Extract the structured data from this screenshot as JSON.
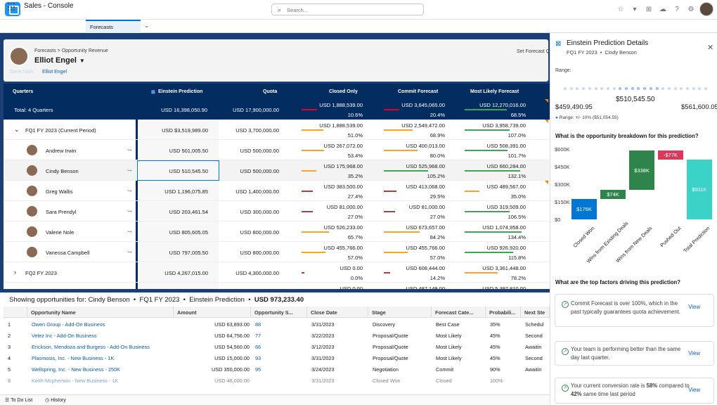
{
  "header": {
    "search_placeholder": "Search..."
  },
  "nav": {
    "app_name": "Sales - Console",
    "tab": "Forecasts"
  },
  "forecast": {
    "breadcrumb": "Forecasts > Opportunity Revenue",
    "owner": "Elliot Engel",
    "set_quota": "Set Forecast Q",
    "sub_link": "Elliot Engel",
    "sub_faint": "Steve Nieh"
  },
  "columns": {
    "quarters": "Quarters",
    "einstein": "Einstein Prediction",
    "quota": "Quota",
    "closed": "Closed Only",
    "commit": "Commit Forecast",
    "likely": "Most Likely Forecast"
  },
  "total": {
    "label": "Total: 4 Quarters",
    "einstein": "USD 16,398,050.90",
    "quota": "USD 17,900,000.00",
    "closed": "USD 1,888,539.00",
    "closed_pct": "10.6%",
    "commit": "USD 3,645,065.00",
    "commit_pct": "20.4%",
    "likely": "USD 12,270,016.00",
    "likely_pct": "68.5%"
  },
  "rows": [
    {
      "name": "FQ1 FY 2023 (Current Period)",
      "einstein": "USD $3,519,989.00",
      "quota": "USD 3,700,000.00",
      "closed": "USD 1,888,539.00",
      "closed_pct": "51.0%",
      "commit": "USD 2,549,472.00",
      "commit_pct": "68.9%",
      "likely": "USD 3,958,739.00",
      "likely_pct": "107.0%"
    },
    {
      "name": "Andrew Irwin",
      "einstein": "USD 501,005.50",
      "quota": "USD 500,000.00",
      "closed": "USD 267,072.00",
      "closed_pct": "53.4%",
      "commit": "USD 400,013.00",
      "commit_pct": "80.0%",
      "likely": "USD 508,391.00",
      "likely_pct": "101.7%"
    },
    {
      "name": "Cindy Benson",
      "einstein": "USD 510,545.50",
      "quota": "USD 500,000.00",
      "closed": "USD 175,968.00",
      "closed_pct": "35.2%",
      "commit": "USD 525,968.00",
      "commit_pct": "105.2%",
      "likely": "USD 660,284.00",
      "likely_pct": "132.1%"
    },
    {
      "name": "Greg Wallis",
      "einstein": "USD 1,196,075.85",
      "quota": "USD 1,400,000.00",
      "closed": "USD 383,500.00",
      "closed_pct": "27.4%",
      "commit": "USD 413,068.00",
      "commit_pct": "29.5%",
      "likely": "USD 489,567.00",
      "likely_pct": "35.0%"
    },
    {
      "name": "Sara Prendyl",
      "einstein": "USD 203,461.54",
      "quota": "USD 300,000.00",
      "closed": "USD 81,000.00",
      "closed_pct": "27.0%",
      "commit": "USD 81,000.00",
      "commit_pct": "27.0%",
      "likely": "USD 319,509.00",
      "likely_pct": "106.5%"
    },
    {
      "name": "Valerie Nole",
      "einstein": "USD 805,605.05",
      "quota": "USD 800,000.00",
      "closed": "USD 526,233.00",
      "closed_pct": "65.7%",
      "commit": "USD 673,657.00",
      "commit_pct": "84.2%",
      "likely": "USD 1,074,958.00",
      "likely_pct": "134.4%"
    },
    {
      "name": "Vanessa Campbell",
      "einstein": "USD 797,005.50",
      "quota": "USD 800,000.00",
      "closed": "USD 455,766.00",
      "closed_pct": "57.0%",
      "commit": "USD 455,766.00",
      "commit_pct": "57.0%",
      "likely": "USD 926,920.00",
      "likely_pct": "115.8%"
    },
    {
      "name": "FQ2 FY 2023",
      "einstein": "USD 4,267,015.00",
      "quota": "USD 4,300,000.00",
      "closed": "USD 0.00",
      "closed_pct": "0.0%",
      "commit": "USD 608,444.00",
      "commit_pct": "14.2%",
      "likely": "USD 3,361,448.00",
      "likely_pct": "78.2%"
    },
    {
      "name": "",
      "einstein": "",
      "quota": "",
      "closed": "USD 0.00",
      "closed_pct": "",
      "commit": "USD 487,149.00",
      "commit_pct": "",
      "likely": "USD 5,397,810.00",
      "likely_pct": ""
    }
  ],
  "list": {
    "showing": "Showing opportunities for: Cindy Benson",
    "period": "FQ1 FY 2023",
    "einstein": "Einstein Prediction",
    "amount": "USD 973,233.40",
    "headers": [
      "Opportunity Name",
      "Amount",
      "Opportunity S...",
      "Close Date",
      "Stage",
      "Forecast Cate...",
      "Probabili...",
      "Next Ste"
    ],
    "rows": [
      [
        "1",
        "Owen Group - Add-On Business",
        "USD 63,893.00",
        "88",
        "3/31/2023",
        "Discovery",
        "Best Case",
        "35%",
        "Schedul"
      ],
      [
        "2",
        "Velez Inc - Add-On Business",
        "USD 64,756.00",
        "77",
        "3/22/2023",
        "Proposal/Quote",
        "Most Likely",
        "45%",
        "Second"
      ],
      [
        "3",
        "Erickson, Mendoza and Burgess - Add-On Business",
        "USD 54,560.00",
        "66",
        "3/12/2023",
        "Proposal/Quote",
        "Most Likely",
        "45%",
        "Awaitin"
      ],
      [
        "4",
        "Plasmosis, Inc. - New Business - 1K",
        "USD 15,000.00",
        "93",
        "3/31/2023",
        "Proposal/Quote",
        "Most Likely",
        "45%",
        "Second"
      ],
      [
        "5",
        "Wellspring, Inc. - New Business - 250K",
        "USD 350,000.00",
        "95",
        "3/24/2023",
        "Negotiation",
        "Commit",
        "90%",
        "Awaitin"
      ],
      [
        "6",
        "Keith-Mcpherson - New Business - 1K",
        "USD 48,000.00",
        "",
        "3/31/2023",
        "Closed Won",
        "Closed",
        "100%",
        ""
      ]
    ]
  },
  "footer": {
    "todo": "To Do List",
    "history": "History"
  },
  "panel": {
    "title": "Einstein Prediction Details",
    "period": "FQ1 FY 2023",
    "person": "Cindy Benson",
    "range_label": "Range:",
    "center": "$510,545.50",
    "low": "$459,490.95",
    "high": "$561,600.05",
    "range_note": "Range: +/- 10% ($51,054.55)",
    "q1": "What is the opportunity breakdown for this prediction?",
    "q2": "What are the top factors driving this prediction?",
    "factors": [
      {
        "text": "Commit Forecast is over 100%, which in the past typically guarantees quota achievement.",
        "view": "View"
      },
      {
        "text": "Your team is performing better than the same day last quarter.",
        "view": "View"
      },
      {
        "pre": "Your current conversion rate is ",
        "b1": "58%",
        "mid": " compared to ",
        "b2": "42%",
        "post": " same time last period",
        "view": "View"
      }
    ]
  },
  "chart_data": {
    "type": "bar",
    "subtype": "waterfall",
    "categories": [
      "Closed Won",
      "Wins from Existing Deals",
      "Wins from New Deals",
      "Pushed Out",
      "Total Prediction"
    ],
    "values": [
      176,
      74,
      338,
      -77,
      511
    ],
    "labels": [
      "$176K",
      "$74K",
      "$338K",
      "-$77K",
      "$511K"
    ],
    "yticks": [
      "$0",
      "$150K",
      "$300K",
      "$450K",
      "$600K"
    ],
    "ylim": [
      0,
      600
    ],
    "colors": [
      "#0176d3",
      "#2e844a",
      "#2e844a",
      "#d83a5b",
      "#3bd3c8"
    ]
  }
}
